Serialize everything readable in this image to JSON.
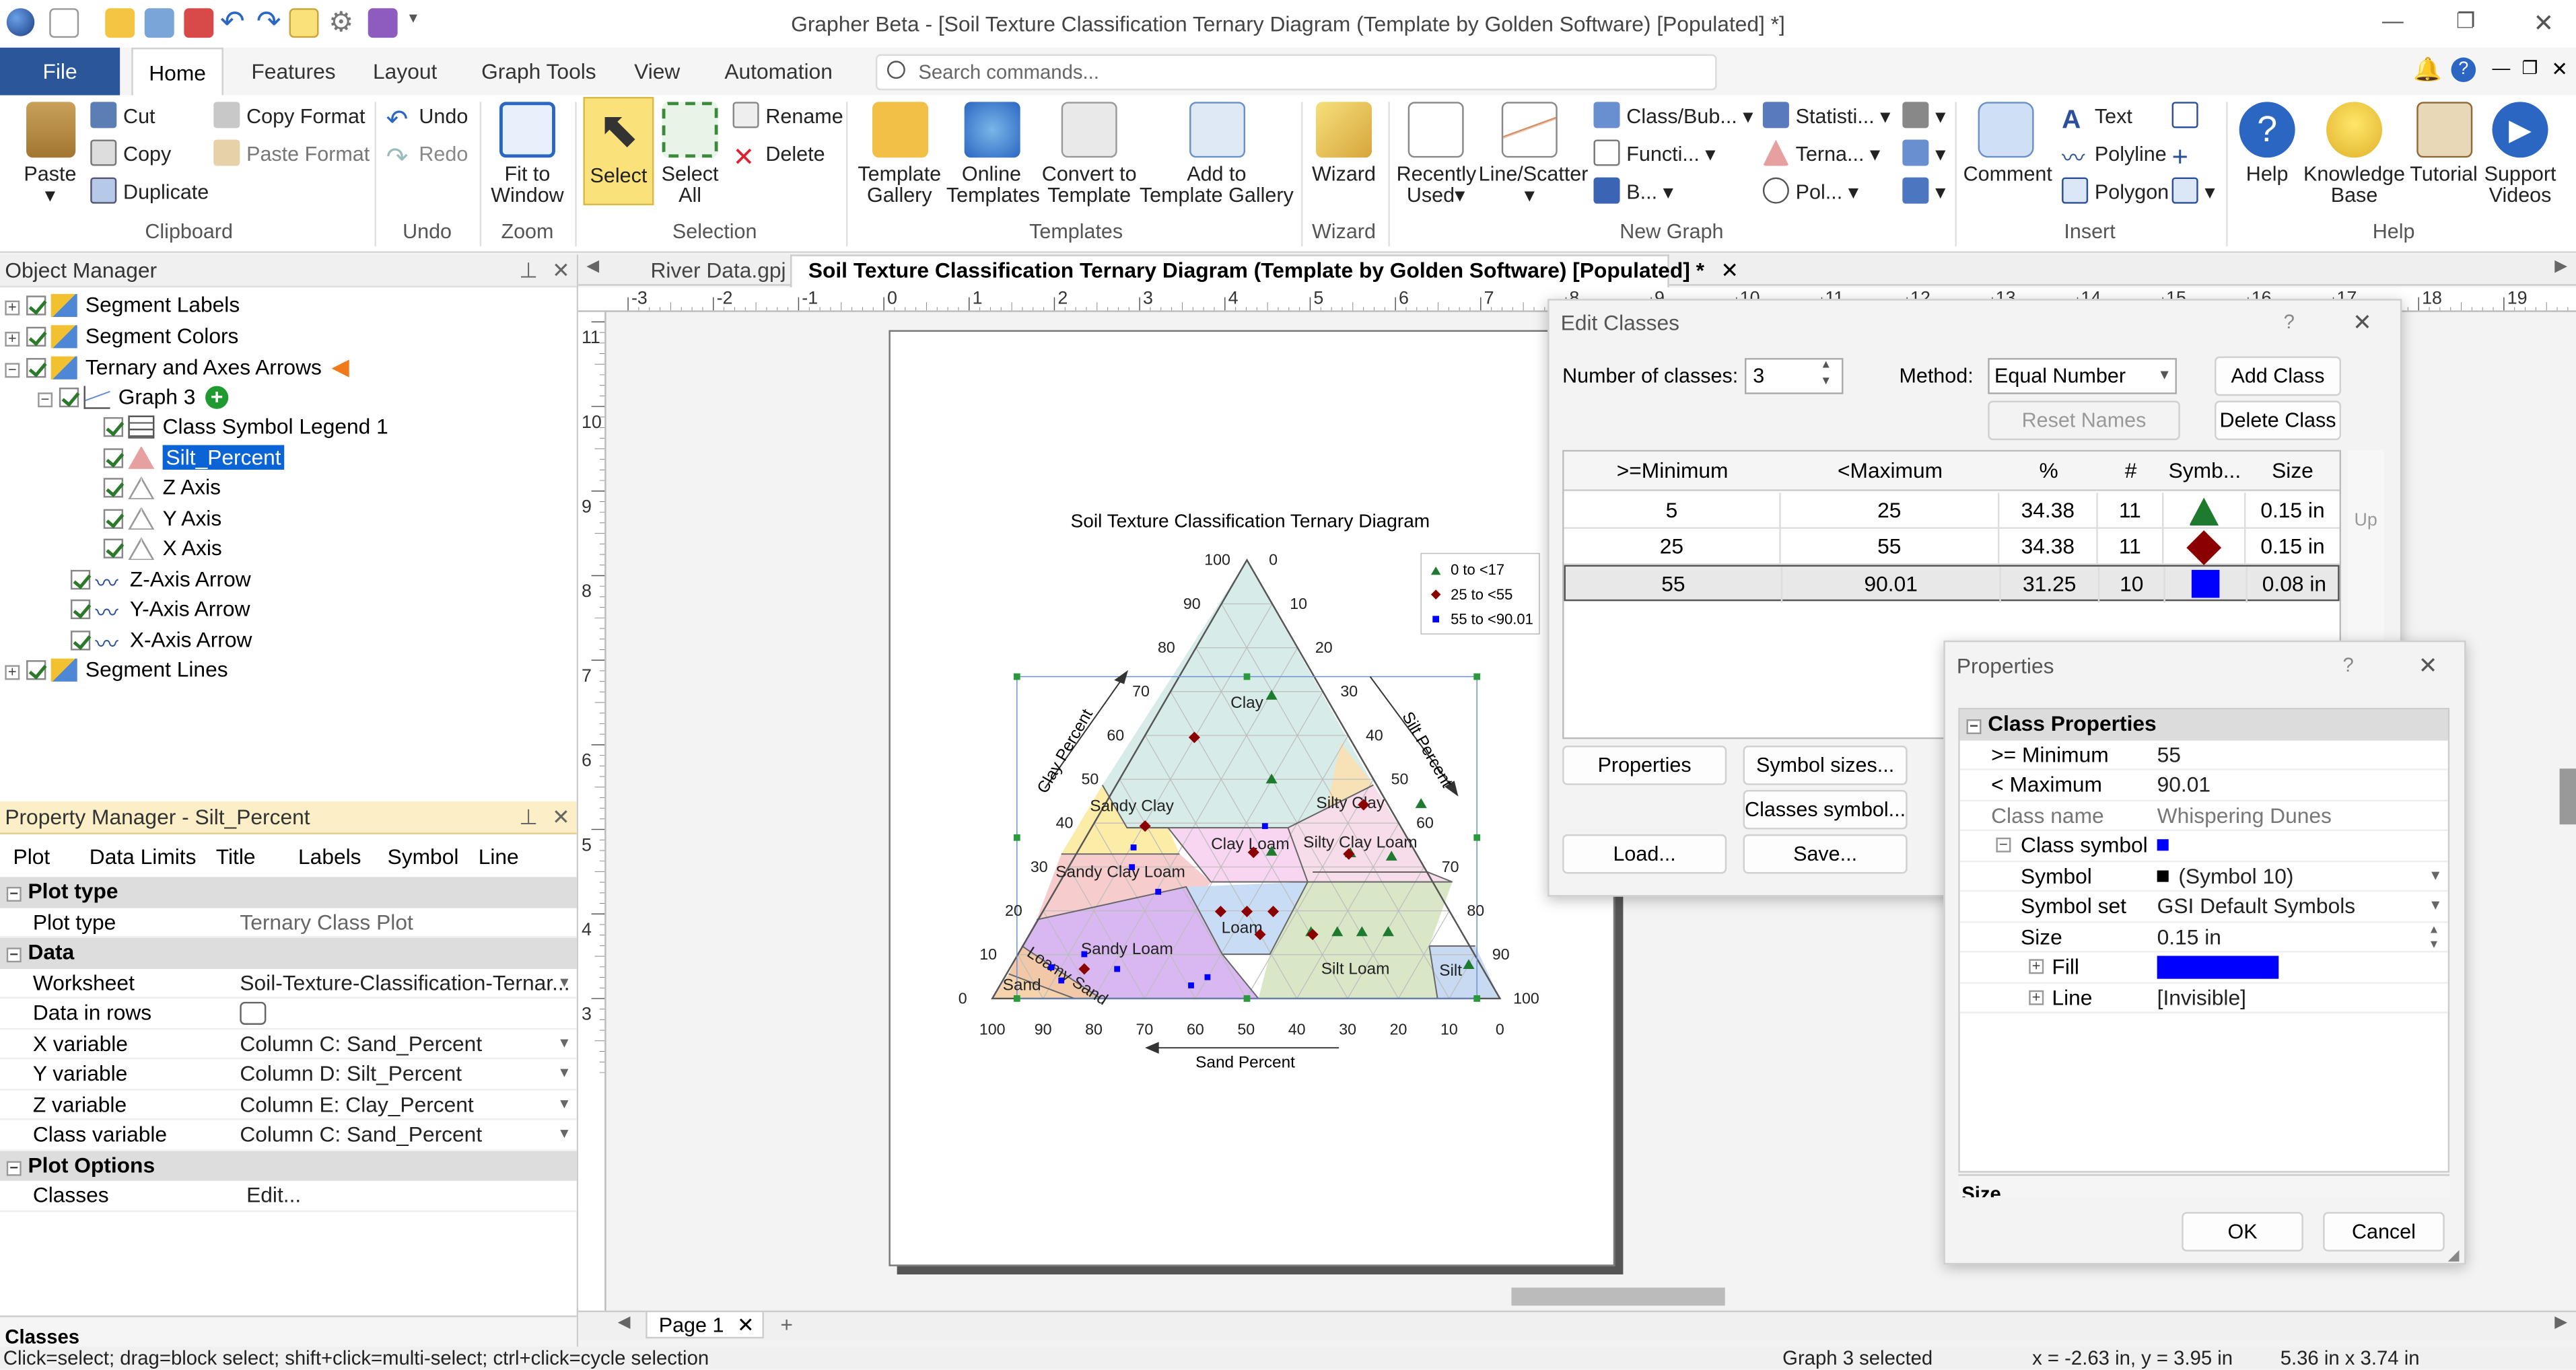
{
  "app": {
    "title": "Grapher Beta - [Soil Texture Classification Ternary Diagram (Template by Golden Software) [Populated] *]"
  },
  "ribbon": {
    "tabs": [
      "File",
      "Home",
      "Features",
      "Layout",
      "Graph Tools",
      "View",
      "Automation"
    ],
    "search_placeholder": "Search commands...",
    "clipboard": {
      "paste": "Paste",
      "cut": "Cut",
      "copy": "Copy",
      "duplicate": "Duplicate",
      "copy_format": "Copy Format",
      "paste_format": "Paste Format",
      "group": "Clipboard"
    },
    "undo": {
      "undo": "Undo",
      "redo": "Redo",
      "group": "Undo"
    },
    "zoom": {
      "fit": "Fit to",
      "fit2": "Window",
      "group": "Zoom"
    },
    "selection": {
      "select": "Select",
      "select_all": "Select",
      "select_all2": "All",
      "rename": "Rename",
      "delete": "Delete",
      "group": "Selection"
    },
    "templates": {
      "gallery": "Template",
      "gallery2": "Gallery",
      "online": "Online",
      "online2": "Templates",
      "convert": "Convert to",
      "convert2": "Template",
      "add": "Add to",
      "add2": "Template Gallery",
      "group": "Templates"
    },
    "wizard": {
      "wizard": "Wizard",
      "group": "Wizard"
    },
    "newgraph": {
      "recent": "Recently",
      "recent2": "Used",
      "line": "Line/Scatter",
      "class": "Class/Bub...",
      "func": "Functi...",
      "bar": "B...",
      "stat": "Statisti...",
      "terna": "Terna...",
      "pol": "Pol...",
      "group": "New Graph"
    },
    "insert": {
      "comment": "Comment",
      "text": "Text",
      "polyline": "Polyline",
      "polygon": "Polygon",
      "group": "Insert"
    },
    "help": {
      "help": "Help",
      "kb": "Knowledge",
      "kb2": "Base",
      "tutorial": "Tutorial",
      "support": "Support",
      "support2": "Videos",
      "group": "Help"
    }
  },
  "object_manager": {
    "title": "Object Manager",
    "items": [
      "Segment Labels",
      "Segment Colors",
      "Ternary and Axes Arrows",
      "Graph 3",
      "Class Symbol Legend 1",
      "Silt_Percent",
      "Z Axis",
      "Y Axis",
      "X Axis",
      "Z-Axis Arrow",
      "Y-Axis Arrow",
      "X-Axis Arrow",
      "Segment Lines"
    ]
  },
  "property_manager": {
    "title": "Property Manager - Silt_Percent",
    "tabs": [
      "Plot",
      "Data Limits",
      "Title",
      "Labels",
      "Symbol",
      "Line"
    ],
    "sections": {
      "plot_type": "Plot type",
      "data": "Data",
      "plot_options": "Plot Options"
    },
    "rows": {
      "plot_type": [
        "Plot type",
        "Ternary Class Plot"
      ],
      "worksheet": [
        "Worksheet",
        "Soil-Texture-Classification-Ternar..."
      ],
      "data_in_rows": [
        "Data in rows",
        ""
      ],
      "x": [
        "X variable",
        "Column C: Sand_Percent"
      ],
      "y": [
        "Y variable",
        "Column D: Silt_Percent"
      ],
      "z": [
        "Z variable",
        "Column E: Clay_Percent"
      ],
      "class": [
        "Class variable",
        "Column C: Sand_Percent"
      ],
      "classes": [
        "Classes",
        "Edit..."
      ]
    },
    "footer": "Classes"
  },
  "doc_tabs": [
    "River Data.gpj",
    "Soil Texture Classification Ternary Diagram (Template by Golden Software) [Populated] *"
  ],
  "ruler": {
    "h": [
      "-3",
      "-2",
      "-1",
      "0",
      "1",
      "2",
      "3",
      "4",
      "5",
      "6",
      "7",
      "8",
      "9",
      "10",
      "11",
      "12",
      "13",
      "14",
      "15",
      "16",
      "17",
      "18",
      "19"
    ],
    "v": [
      "11",
      "10",
      "9",
      "8",
      "7",
      "6",
      "5",
      "4",
      "3"
    ]
  },
  "page_tab": "Page 1",
  "chart": {
    "title": "Soil Texture Classification Ternary Diagram",
    "sand_label": "Sand Percent",
    "clay_label": "Clay Percent",
    "silt_label": "Silt Percent",
    "left_ticks": [
      "100",
      "90",
      "80",
      "70",
      "60",
      "50",
      "40",
      "30",
      "20",
      "10",
      "0"
    ],
    "right_ticks": [
      "0",
      "10",
      "20",
      "30",
      "40",
      "50",
      "60",
      "70",
      "80",
      "90",
      "100"
    ],
    "bottom_ticks": [
      "100",
      "90",
      "80",
      "70",
      "60",
      "50",
      "40",
      "30",
      "20",
      "10",
      "0"
    ],
    "regions": [
      "Clay",
      "Sandy Clay",
      "Silty Clay",
      "Clay Loam",
      "Silty Clay Loam",
      "Sandy Clay Loam",
      "Loam",
      "Sandy Loam",
      "Silt Loam",
      "Silt",
      "Loamy Sand",
      "Sand"
    ],
    "legend": [
      "0 to <17",
      "25 to <55",
      "55 to <90.01"
    ],
    "colors": {
      "class1": "#1d7a2e",
      "class2": "#8b0000",
      "class3": "#0000ff"
    }
  },
  "edit_classes": {
    "title": "Edit Classes",
    "num_label": "Number of classes:",
    "num": "3",
    "method_label": "Method:",
    "method": "Equal Number",
    "add": "Add Class",
    "reset": "Reset Names",
    "delete": "Delete Class",
    "headers": [
      ">=Minimum",
      "<Maximum",
      "%",
      "#",
      "Symb...",
      "Size"
    ],
    "rows": [
      [
        "5",
        "25",
        "34.38",
        "11",
        "0.15 in"
      ],
      [
        "25",
        "55",
        "34.38",
        "11",
        "0.15 in"
      ],
      [
        "55",
        "90.01",
        "31.25",
        "10",
        "0.08 in"
      ]
    ],
    "up": "Up",
    "properties": "Properties",
    "symbol_sizes": "Symbol sizes...",
    "classes_symbol": "Classes symbol...",
    "load": "Load...",
    "save": "Save...",
    "help": "?",
    "close": "✕"
  },
  "properties_dialog": {
    "title": "Properties",
    "section": "Class Properties",
    "rows": [
      [
        ">= Minimum",
        "55"
      ],
      [
        "< Maximum",
        "90.01"
      ],
      [
        "Class name",
        "Whispering Dunes"
      ],
      [
        "Class symbol",
        ""
      ],
      [
        "Symbol",
        "(Symbol 10)"
      ],
      [
        "Symbol set",
        "GSI Default Symbols"
      ],
      [
        "Size",
        "0.15 in"
      ],
      [
        "Fill",
        ""
      ],
      [
        "Line",
        "[Invisible]"
      ]
    ],
    "footer": "Size",
    "ok": "OK",
    "cancel": "Cancel"
  },
  "status": {
    "hint": "Click=select; drag=block select; shift+click=multi-select; ctrl+click=cycle selection",
    "selected": "Graph 3 selected",
    "coords": "x = -2.63 in, y = 3.95 in",
    "size": "5.36 in x 3.74 in"
  }
}
